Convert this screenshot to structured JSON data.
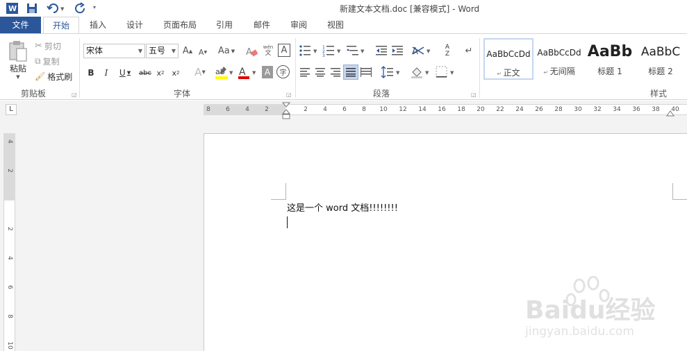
{
  "window": {
    "title": "新建文本文档.doc [兼容模式] - Word"
  },
  "quick_access": {
    "app_icon": "word-app-icon",
    "icons": [
      "save-icon",
      "undo-icon",
      "redo-icon",
      "customize-icon"
    ]
  },
  "tabs": [
    "文件",
    "开始",
    "插入",
    "设计",
    "页面布局",
    "引用",
    "邮件",
    "审阅",
    "视图"
  ],
  "ribbon": {
    "clipboard": {
      "label": "剪贴板",
      "paste": "粘贴",
      "cut": "剪切",
      "copy": "复制",
      "format_painter": "格式刷"
    },
    "font": {
      "label": "字体",
      "font_name": "宋体",
      "font_size": "五号",
      "change_case": "Aa"
    },
    "paragraph": {
      "label": "段落"
    },
    "styles": {
      "label": "样式",
      "items": [
        {
          "sample": "AaBbCcDd",
          "name": "正文"
        },
        {
          "sample": "AaBbCcDd",
          "name": "无间隔"
        },
        {
          "sample": "AaBb",
          "name": "标题 1"
        },
        {
          "sample": "AaBbC",
          "name": "标题 2"
        }
      ]
    }
  },
  "ruler": {
    "h_ticks": [
      "8",
      "6",
      "4",
      "2",
      "2",
      "4",
      "6",
      "8",
      "10",
      "12",
      "14",
      "16",
      "18",
      "20",
      "22",
      "24",
      "26",
      "28",
      "30",
      "32",
      "34",
      "36",
      "38",
      "40"
    ],
    "v_ticks": [
      "4",
      "2",
      "2",
      "4",
      "6",
      "8",
      "10"
    ]
  },
  "document": {
    "text": "这是一个 word 文档!!!!!!!!"
  },
  "watermark": {
    "brand": "Baidu经验",
    "url": "jingyan.baidu.com"
  },
  "colors": {
    "accent": "#2b579a",
    "highlight": "#ffff00",
    "font_color": "#e00000"
  }
}
